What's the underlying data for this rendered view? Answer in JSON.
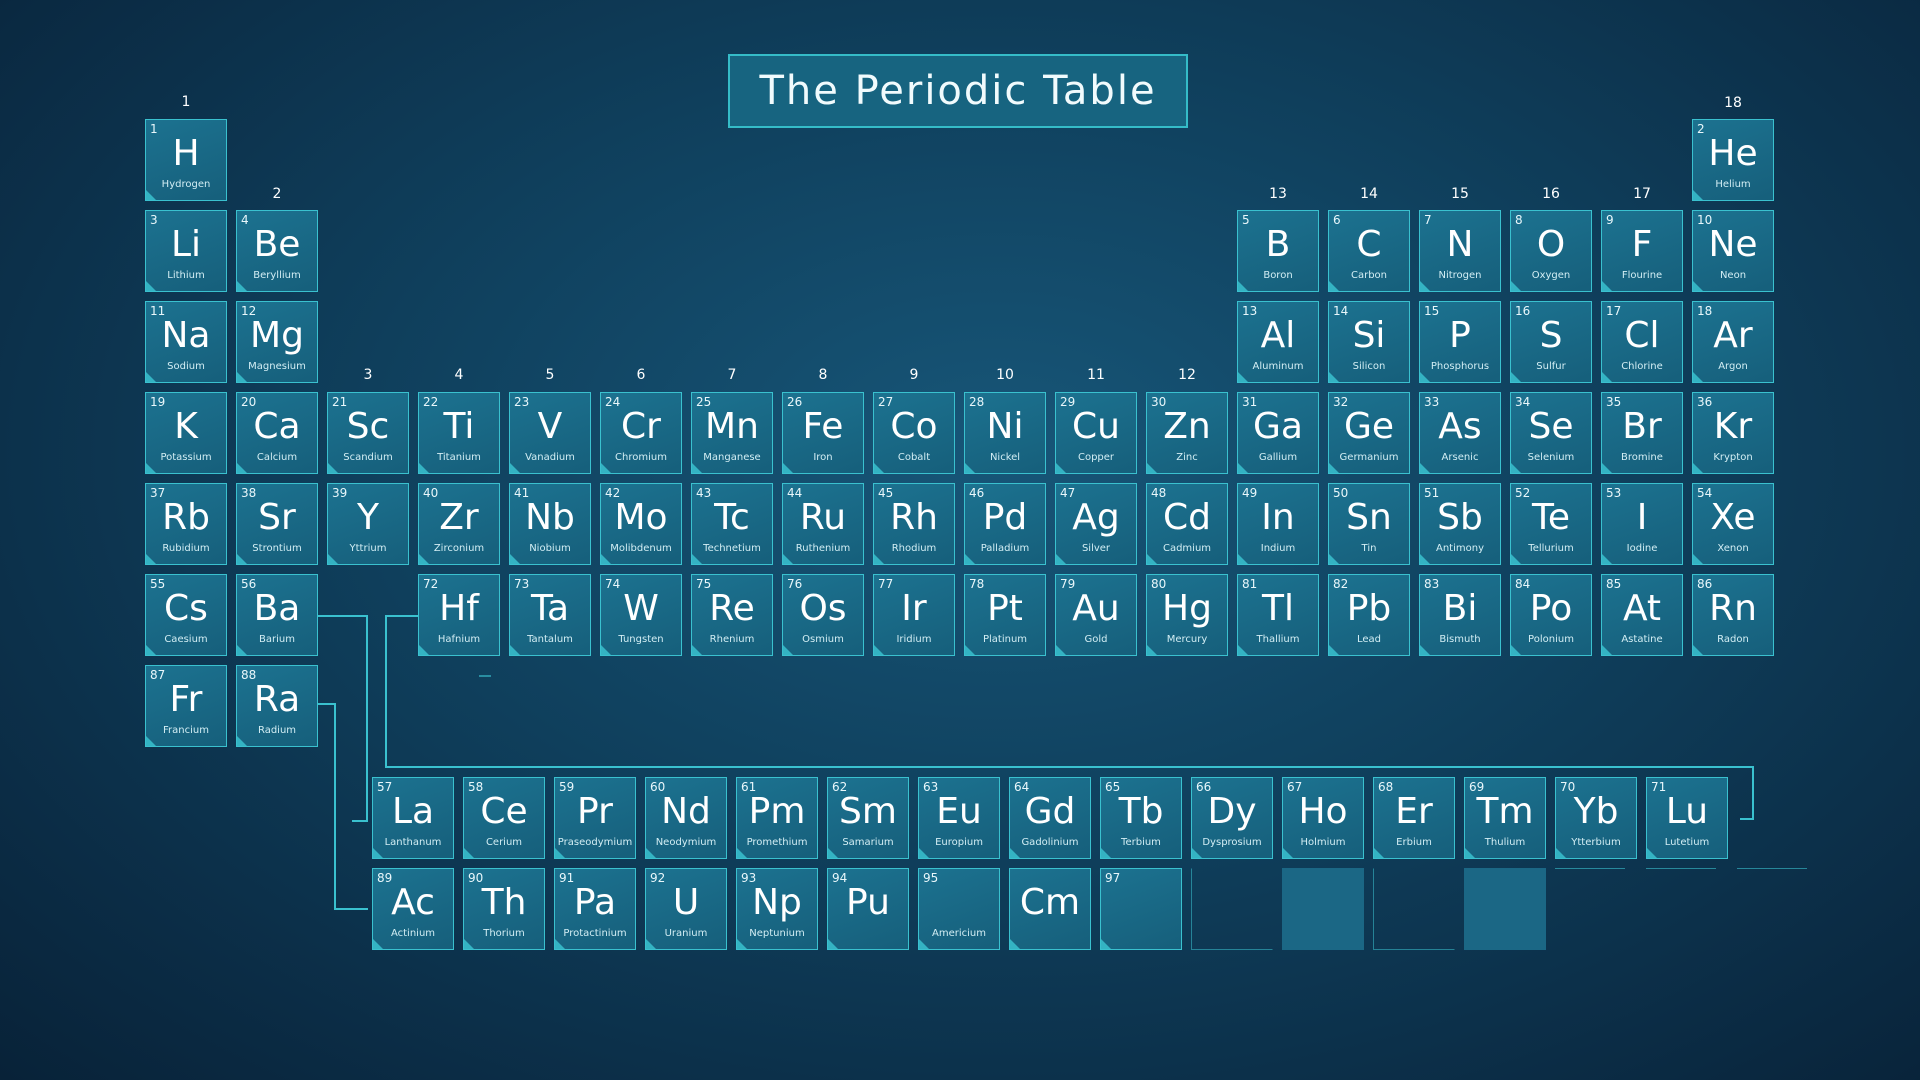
{
  "title": "The Periodic Table",
  "colors": {
    "accent": "#3ac1cf",
    "tile": "#176480",
    "background": "#0f3f5c"
  },
  "groups": [
    "1",
    "2",
    "3",
    "4",
    "5",
    "6",
    "7",
    "8",
    "9",
    "10",
    "11",
    "12",
    "13",
    "14",
    "15",
    "16",
    "17",
    "18"
  ],
  "elements": [
    {
      "n": "1",
      "s": "H",
      "name": "Hydrogen"
    },
    {
      "n": "2",
      "s": "He",
      "name": "Helium"
    },
    {
      "n": "3",
      "s": "Li",
      "name": "Lithium"
    },
    {
      "n": "4",
      "s": "Be",
      "name": "Beryllium"
    },
    {
      "n": "5",
      "s": "B",
      "name": "Boron"
    },
    {
      "n": "6",
      "s": "C",
      "name": "Carbon"
    },
    {
      "n": "7",
      "s": "N",
      "name": "Nitrogen"
    },
    {
      "n": "8",
      "s": "O",
      "name": "Oxygen"
    },
    {
      "n": "9",
      "s": "F",
      "name": "Flourine"
    },
    {
      "n": "10",
      "s": "Ne",
      "name": "Neon"
    },
    {
      "n": "11",
      "s": "Na",
      "name": "Sodium"
    },
    {
      "n": "12",
      "s": "Mg",
      "name": "Magnesium"
    },
    {
      "n": "13",
      "s": "Al",
      "name": "Aluminum"
    },
    {
      "n": "14",
      "s": "Si",
      "name": "Silicon"
    },
    {
      "n": "15",
      "s": "P",
      "name": "Phosphorus"
    },
    {
      "n": "16",
      "s": "S",
      "name": "Sulfur"
    },
    {
      "n": "17",
      "s": "Cl",
      "name": "Chlorine"
    },
    {
      "n": "18",
      "s": "Ar",
      "name": "Argon"
    },
    {
      "n": "19",
      "s": "K",
      "name": "Potassium"
    },
    {
      "n": "20",
      "s": "Ca",
      "name": "Calcium"
    },
    {
      "n": "21",
      "s": "Sc",
      "name": "Scandium"
    },
    {
      "n": "22",
      "s": "Ti",
      "name": "Titanium"
    },
    {
      "n": "23",
      "s": "V",
      "name": "Vanadium"
    },
    {
      "n": "24",
      "s": "Cr",
      "name": "Chromium"
    },
    {
      "n": "25",
      "s": "Mn",
      "name": "Manganese"
    },
    {
      "n": "26",
      "s": "Fe",
      "name": "Iron"
    },
    {
      "n": "27",
      "s": "Co",
      "name": "Cobalt"
    },
    {
      "n": "28",
      "s": "Ni",
      "name": "Nickel"
    },
    {
      "n": "29",
      "s": "Cu",
      "name": "Copper"
    },
    {
      "n": "30",
      "s": "Zn",
      "name": "Zinc"
    },
    {
      "n": "31",
      "s": "Ga",
      "name": "Gallium"
    },
    {
      "n": "32",
      "s": "Ge",
      "name": "Germanium"
    },
    {
      "n": "33",
      "s": "As",
      "name": "Arsenic"
    },
    {
      "n": "34",
      "s": "Se",
      "name": "Selenium"
    },
    {
      "n": "35",
      "s": "Br",
      "name": "Bromine"
    },
    {
      "n": "36",
      "s": "Kr",
      "name": "Krypton"
    },
    {
      "n": "37",
      "s": "Rb",
      "name": "Rubidium"
    },
    {
      "n": "38",
      "s": "Sr",
      "name": "Strontium"
    },
    {
      "n": "39",
      "s": "Y",
      "name": "Yttrium"
    },
    {
      "n": "40",
      "s": "Zr",
      "name": "Zirconium"
    },
    {
      "n": "41",
      "s": "Nb",
      "name": "Niobium"
    },
    {
      "n": "42",
      "s": "Mo",
      "name": "Molibdenum"
    },
    {
      "n": "43",
      "s": "Tc",
      "name": "Technetium"
    },
    {
      "n": "44",
      "s": "Ru",
      "name": "Ruthenium"
    },
    {
      "n": "45",
      "s": "Rh",
      "name": "Rhodium"
    },
    {
      "n": "46",
      "s": "Pd",
      "name": "Palladium"
    },
    {
      "n": "47",
      "s": "Ag",
      "name": "Silver"
    },
    {
      "n": "48",
      "s": "Cd",
      "name": "Cadmium"
    },
    {
      "n": "49",
      "s": "In",
      "name": "Indium"
    },
    {
      "n": "50",
      "s": "Sn",
      "name": "Tin"
    },
    {
      "n": "51",
      "s": "Sb",
      "name": "Antimony"
    },
    {
      "n": "52",
      "s": "Te",
      "name": "Tellurium"
    },
    {
      "n": "53",
      "s": "I",
      "name": "Iodine"
    },
    {
      "n": "54",
      "s": "Xe",
      "name": "Xenon"
    },
    {
      "n": "55",
      "s": "Cs",
      "name": "Caesium"
    },
    {
      "n": "56",
      "s": "Ba",
      "name": "Barium"
    },
    {
      "n": "72",
      "s": "Hf",
      "name": "Hafnium"
    },
    {
      "n": "73",
      "s": "Ta",
      "name": "Tantalum"
    },
    {
      "n": "74",
      "s": "W",
      "name": "Tungsten"
    },
    {
      "n": "75",
      "s": "Re",
      "name": "Rhenium"
    },
    {
      "n": "76",
      "s": "Os",
      "name": "Osmium"
    },
    {
      "n": "77",
      "s": "Ir",
      "name": "Iridium"
    },
    {
      "n": "78",
      "s": "Pt",
      "name": "Platinum"
    },
    {
      "n": "79",
      "s": "Au",
      "name": "Gold"
    },
    {
      "n": "80",
      "s": "Hg",
      "name": "Mercury"
    },
    {
      "n": "81",
      "s": "Tl",
      "name": "Thallium"
    },
    {
      "n": "82",
      "s": "Pb",
      "name": "Lead"
    },
    {
      "n": "83",
      "s": "Bi",
      "name": "Bismuth"
    },
    {
      "n": "84",
      "s": "Po",
      "name": "Polonium"
    },
    {
      "n": "85",
      "s": "At",
      "name": "Astatine"
    },
    {
      "n": "86",
      "s": "Rn",
      "name": "Radon"
    },
    {
      "n": "87",
      "s": "Fr",
      "name": "Francium"
    },
    {
      "n": "88",
      "s": "Ra",
      "name": "Radium"
    },
    {
      "n": "57",
      "s": "La",
      "name": "Lanthanum"
    },
    {
      "n": "58",
      "s": "Ce",
      "name": "Cerium"
    },
    {
      "n": "59",
      "s": "Pr",
      "name": "Praseodymium"
    },
    {
      "n": "60",
      "s": "Nd",
      "name": "Neodymium"
    },
    {
      "n": "61",
      "s": "Pm",
      "name": "Promethium"
    },
    {
      "n": "62",
      "s": "Sm",
      "name": "Samarium"
    },
    {
      "n": "63",
      "s": "Eu",
      "name": "Europium"
    },
    {
      "n": "64",
      "s": "Gd",
      "name": "Gadolinium"
    },
    {
      "n": "65",
      "s": "Tb",
      "name": "Terbium"
    },
    {
      "n": "66",
      "s": "Dy",
      "name": "Dysprosium"
    },
    {
      "n": "67",
      "s": "Ho",
      "name": "Holmium"
    },
    {
      "n": "68",
      "s": "Er",
      "name": "Erbium"
    },
    {
      "n": "69",
      "s": "Tm",
      "name": "Thulium"
    },
    {
      "n": "70",
      "s": "Yb",
      "name": "Ytterbium"
    },
    {
      "n": "71",
      "s": "Lu",
      "name": "Lutetium"
    },
    {
      "n": "89",
      "s": "Ac",
      "name": "Actinium"
    },
    {
      "n": "90",
      "s": "Th",
      "name": "Thorium"
    },
    {
      "n": "91",
      "s": "Pa",
      "name": "Protactinium"
    },
    {
      "n": "92",
      "s": "U",
      "name": "Uranium"
    },
    {
      "n": "93",
      "s": "Np",
      "name": "Neptunium"
    },
    {
      "n": "94",
      "s": "Pu",
      "name": ""
    },
    {
      "n": "95",
      "s": "",
      "name": "Americium"
    },
    {
      "n": "",
      "s": "Cm",
      "name": ""
    },
    {
      "n": "97",
      "s": "",
      "name": ""
    }
  ]
}
